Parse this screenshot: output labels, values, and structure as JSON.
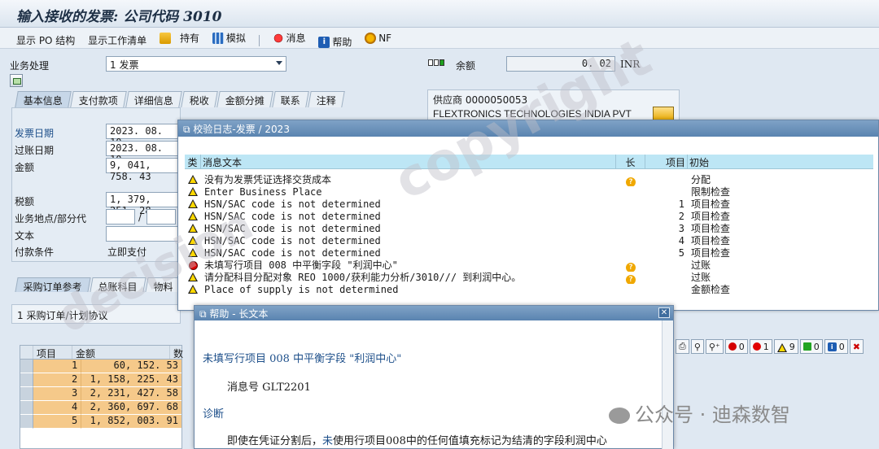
{
  "window": {
    "title": "输入接收的发票: 公司代码 3010"
  },
  "toolbar": {
    "items": [
      {
        "label": "显示 PO 结构"
      },
      {
        "label": "显示工作清单"
      },
      {
        "label": "持有"
      },
      {
        "label": "模拟"
      },
      {
        "label": "消息"
      },
      {
        "label": "帮助"
      },
      {
        "label": "NF"
      }
    ]
  },
  "header": {
    "transaction_label": "业务处理",
    "transaction_value": "1 发票",
    "balance_label": "余额",
    "balance_value": "0. 02",
    "currency": "INR"
  },
  "tabs": [
    {
      "label": "基本信息"
    },
    {
      "label": "支付款项"
    },
    {
      "label": "详细信息"
    },
    {
      "label": "税收"
    },
    {
      "label": "金额分摊"
    },
    {
      "label": "联系"
    },
    {
      "label": "注释"
    }
  ],
  "vendor": {
    "label": "供应商 0000050053",
    "name": "FLEXTRONICS TECHNOLOGIES INDIA PVT"
  },
  "basic": {
    "invoice_date_label": "发票日期",
    "invoice_date": "2023. 08. 10",
    "posting_date_label": "过账日期",
    "posting_date": "2023. 08. 10",
    "amount_label": "金额",
    "amount": "9, 041, 758. 43",
    "tax_label": "税额",
    "tax": "1, 379, 251. 28",
    "bizplace_label": "业务地点/部分代",
    "text_label": "文本",
    "payterms_label": "付款条件",
    "payterms_value": "立即支付"
  },
  "lower_tabs": [
    {
      "label": "采购订单参考"
    },
    {
      "label": "总账科目"
    },
    {
      "label": "物料"
    }
  ],
  "po_ref": {
    "selection": "1 采购订单/计划协议",
    "columns": [
      "项目",
      "金额",
      "数"
    ],
    "rows": [
      {
        "item": "1",
        "amount": "60, 152. 53"
      },
      {
        "item": "2",
        "amount": "1, 158, 225. 43"
      },
      {
        "item": "3",
        "amount": "2, 231, 427. 58"
      },
      {
        "item": "4",
        "amount": "2, 360, 697. 68"
      },
      {
        "item": "5",
        "amount": "1, 852, 003. 91"
      }
    ]
  },
  "log_dialog": {
    "title": "校验日志-发票 / 2023",
    "columns": {
      "type": "类",
      "text": "消息文本",
      "long": "长",
      "item": "项目",
      "origin": "初始"
    },
    "rows": [
      {
        "type": "warning",
        "text": "没有为发票凭证选择交货成本",
        "long": true,
        "item": "",
        "origin": "分配"
      },
      {
        "type": "warning",
        "text": "Enter Business Place",
        "long": false,
        "item": "",
        "origin": "限制检查"
      },
      {
        "type": "warning",
        "text": "HSN/SAC code is not determined",
        "long": false,
        "item": "1",
        "origin": "项目检查"
      },
      {
        "type": "warning",
        "text": "HSN/SAC code is not determined",
        "long": false,
        "item": "2",
        "origin": "项目检查"
      },
      {
        "type": "warning",
        "text": "HSN/SAC code is not determined",
        "long": false,
        "item": "3",
        "origin": "项目检查"
      },
      {
        "type": "warning",
        "text": "HSN/SAC code is not determined",
        "long": false,
        "item": "4",
        "origin": "项目检查"
      },
      {
        "type": "warning",
        "text": "HSN/SAC code is not determined",
        "long": false,
        "item": "5",
        "origin": "项目检查"
      },
      {
        "type": "error",
        "text": "未填写行项目 008 中平衡字段 \"利润中心\"",
        "long": true,
        "item": "",
        "origin": "过账"
      },
      {
        "type": "warning",
        "text": "请分配科目分配对象 REO 1000/获利能力分析/3010/// 到利润中心。",
        "long": true,
        "item": "",
        "origin": "过账"
      },
      {
        "type": "warning",
        "text": "Place of supply is not determined",
        "long": false,
        "item": "",
        "origin": "金额检查"
      }
    ]
  },
  "status_counts": [
    {
      "kind": "stop",
      "count": "0",
      "color": "#d40000"
    },
    {
      "kind": "error",
      "count": "1",
      "color": "#e10000"
    },
    {
      "kind": "warning",
      "count": "9",
      "color": "#ffd800"
    },
    {
      "kind": "success",
      "count": "0",
      "color": "#22a422"
    },
    {
      "kind": "info",
      "count": "0",
      "color": "#1e5db3"
    }
  ],
  "help_dialog": {
    "title": "帮助 - 长文本",
    "heading": "未填写行项目 008 中平衡字段 \"利润中心\"",
    "message_no": "消息号 GLT2201",
    "diag_label": "诊断",
    "diag_text_a": "即使在凭证分割后，",
    "diag_text_b": "未",
    "diag_text_c": "使用行项目008中的任何值填充标记为结清的字段利润中心",
    "diag_text_d": "。"
  },
  "watermarks": {
    "main": "copyright",
    "side": "decision",
    "footer": "公众号 · 迪森数智"
  }
}
